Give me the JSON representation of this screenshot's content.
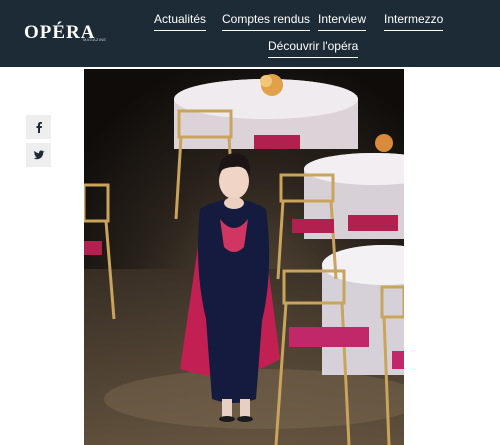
{
  "site": {
    "logo_text": "OPÉRA",
    "logo_sub": "MAGAZINE"
  },
  "nav": {
    "items": [
      {
        "label": "Actualités"
      },
      {
        "label": "Comptes rendus"
      },
      {
        "label": "Interview"
      },
      {
        "label": "Intermezzo"
      },
      {
        "label": "Découvrir l'opéra"
      }
    ]
  },
  "share": {
    "icons": [
      "facebook-icon",
      "twitter-icon"
    ]
  },
  "article": {
    "photo_subject": ""
  },
  "colors": {
    "header_bg": "#1d2b36",
    "accent_white": "#ffffff",
    "share_bg": "#eeeeee",
    "share_icon": "#1d2b36"
  }
}
